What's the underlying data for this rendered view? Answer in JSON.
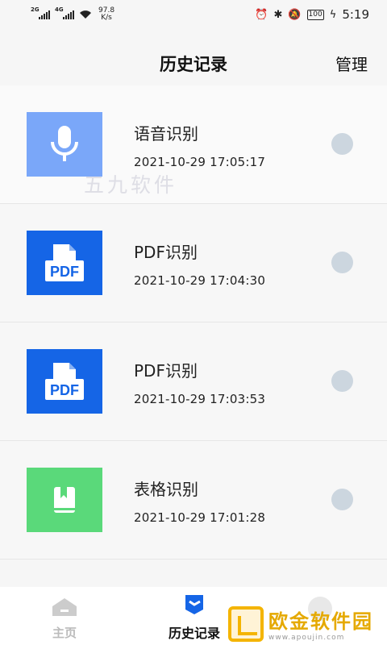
{
  "status_bar": {
    "net1": "2G",
    "net2": "4G",
    "speed_value": "97.8",
    "speed_unit": "K/s",
    "battery": "100",
    "time": "5:19"
  },
  "header": {
    "title": "历史记录",
    "manage_label": "管理"
  },
  "items": [
    {
      "title": "语音识别",
      "time": "2021-10-29 17:05:17",
      "icon": "microphone-icon",
      "color": "#7aa7f9"
    },
    {
      "title": "PDF识别",
      "time": "2021-10-29 17:04:30",
      "icon": "pdf-file-icon",
      "color": "#1565e6",
      "icon_text": "PDF"
    },
    {
      "title": "PDF识别",
      "time": "2021-10-29 17:03:53",
      "icon": "pdf-file-icon",
      "color": "#1565e6",
      "icon_text": "PDF"
    },
    {
      "title": "表格识别",
      "time": "2021-10-29 17:01:28",
      "icon": "bookmark-book-icon",
      "color": "#5ad97a"
    }
  ],
  "watermark": "五九软件",
  "bottom_nav": {
    "home_label": "主页",
    "history_label": "历史记录"
  },
  "logo": {
    "name": "欧金软件园",
    "url": "www.apoujin.com"
  }
}
